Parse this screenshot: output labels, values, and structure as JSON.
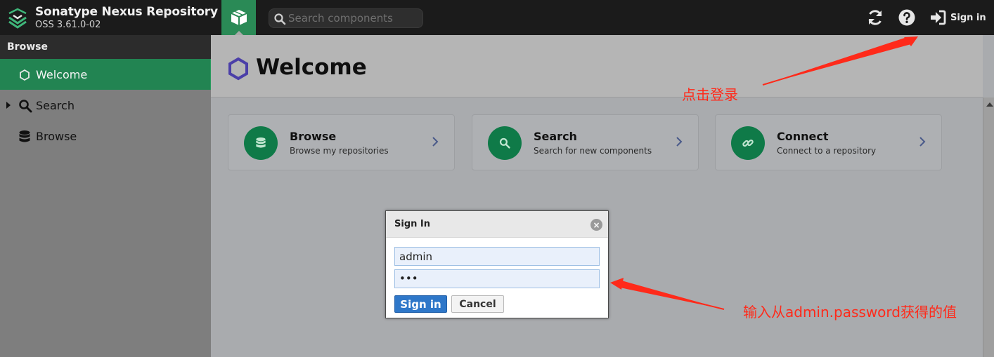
{
  "header": {
    "app_title": "Sonatype Nexus Repository",
    "app_version": "OSS 3.61.0-02",
    "search_placeholder": "Search components",
    "sign_in_label": "Sign in",
    "icons": [
      "nexus-logo-icon",
      "cube-icon",
      "search-icon",
      "refresh-icon",
      "help-icon",
      "sign-in-icon"
    ]
  },
  "sidebar": {
    "title": "Browse",
    "items": [
      {
        "label": "Welcome",
        "icon": "hexagon-icon",
        "active": true
      },
      {
        "label": "Search",
        "icon": "search-icon",
        "expandable": true
      },
      {
        "label": "Browse",
        "icon": "database-icon"
      }
    ]
  },
  "main": {
    "title": "Welcome",
    "cards": [
      {
        "title": "Browse",
        "subtitle": "Browse my repositories",
        "icon": "database-icon"
      },
      {
        "title": "Search",
        "subtitle": "Search for new components",
        "icon": "search-icon"
      },
      {
        "title": "Connect",
        "subtitle": "Connect to a repository",
        "icon": "link-icon"
      }
    ]
  },
  "dialog": {
    "title": "Sign In",
    "username_value": "admin",
    "password_value": "•••",
    "sign_in_label": "Sign in",
    "cancel_label": "Cancel"
  },
  "annotations": {
    "click_login": "点击登录",
    "enter_password": "输入从admin.password获得的值",
    "color": "#ff2a1a"
  },
  "colors": {
    "accent_green": "#228452",
    "header_bg": "#1b1b1b",
    "primary_button": "#2e77c9",
    "welcome_icon": "#4b3fa8"
  }
}
